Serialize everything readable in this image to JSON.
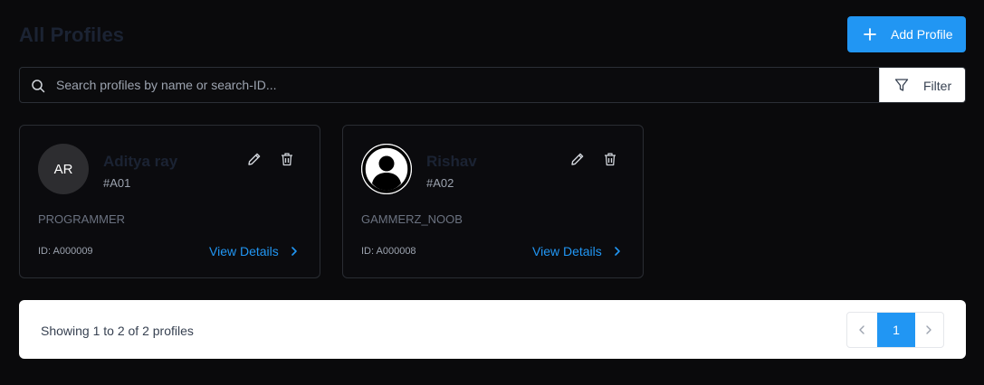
{
  "header": {
    "title": "All Profiles",
    "add_button_label": "Add Profile"
  },
  "search": {
    "placeholder": "Search profiles by name or search-ID...",
    "value": "",
    "filter_label": "Filter"
  },
  "profiles": [
    {
      "initials": "AR",
      "name": "Aditya ray",
      "code": "#A01",
      "role": "PROGRAMMER",
      "id_text": "ID: A000009",
      "link_label": "View Details",
      "avatar_type": "initials"
    },
    {
      "initials": "",
      "name": "Rishav",
      "code": "#A02",
      "role": "GAMMERZ_NOOB",
      "id_text": "ID: A000008",
      "link_label": "View Details",
      "avatar_type": "user-icon"
    }
  ],
  "pagination": {
    "summary": "Showing 1 to 2 of 2 profiles",
    "current_page": "1"
  },
  "colors": {
    "accent": "#2196f3",
    "background": "#0a0a0c",
    "card_border": "#2a2d33"
  }
}
